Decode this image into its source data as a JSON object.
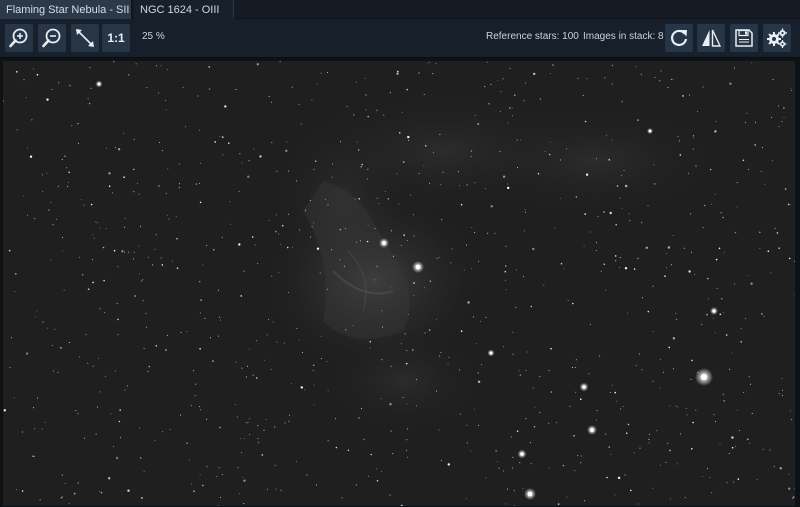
{
  "tabs": [
    {
      "label": "Flaming Star Nebula - SII",
      "active": true
    },
    {
      "label": "NGC 1624 - OIII",
      "active": false
    }
  ],
  "toolbar": {
    "one_to_one_label": "1:1",
    "zoom_level": "25 %",
    "reference_stars": "Reference stars: 100",
    "images_in_stack": "Images in stack: 8"
  },
  "icons": {
    "zoom_in": "zoom-in-icon",
    "zoom_out": "zoom-out-icon",
    "fit": "fit-to-window-icon",
    "rotate": "rotate-icon",
    "flip": "flip-icon",
    "save": "save-icon",
    "settings": "settings-icon",
    "close_tab": "trash-icon"
  },
  "colors": {
    "accent": "#263646",
    "tab_active": "#2a3a4b",
    "background": "#131a22",
    "sky": "#202020"
  }
}
